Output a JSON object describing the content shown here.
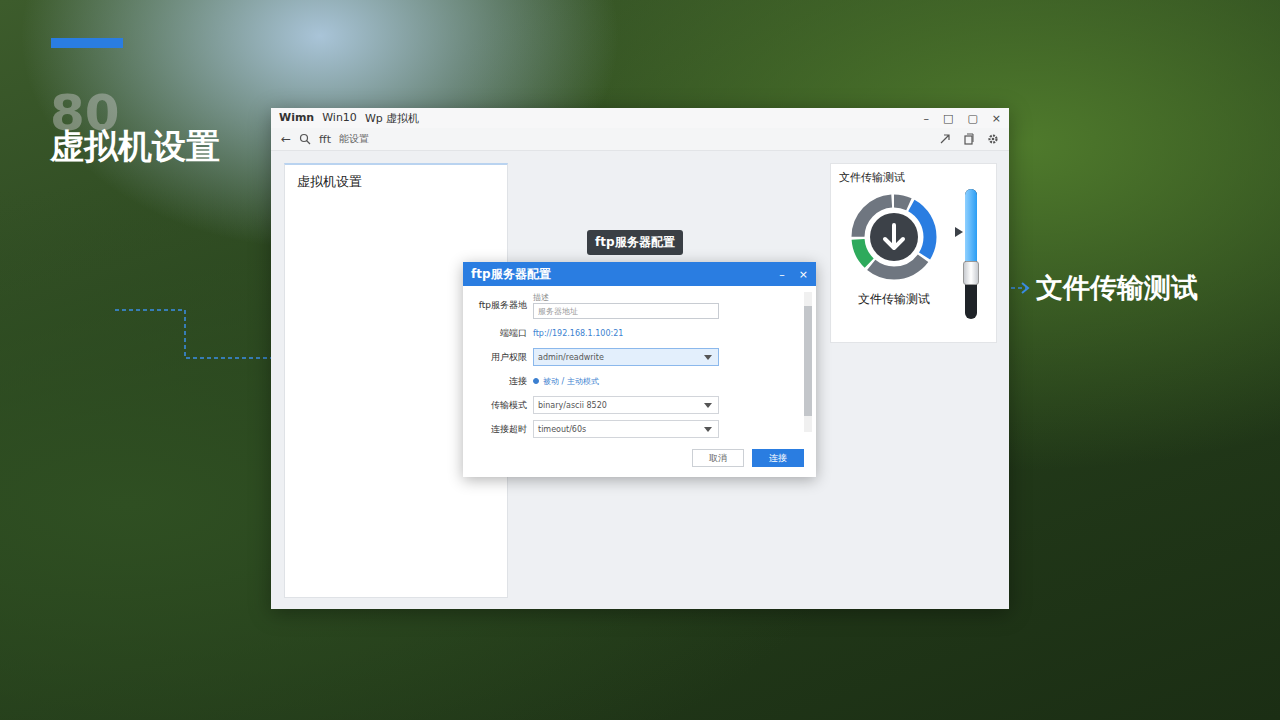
{
  "slide": {
    "number": "80",
    "title": "虚拟机设置",
    "callout": "文件传输测试"
  },
  "window": {
    "title_parts": [
      "Wimn",
      "Win10",
      "Wp 虚拟机"
    ],
    "controls": [
      "–",
      "□",
      "▢",
      "×"
    ]
  },
  "toolbar": {
    "back": "←",
    "search": "fft",
    "breadcrumb": "能设置"
  },
  "sidebar": {
    "title": "虚拟机设置"
  },
  "tooltip": "ftp服务器配置",
  "dialog": {
    "title": "ftp服务器配置",
    "controls": [
      "–",
      "×"
    ],
    "fields": [
      {
        "kind": "input",
        "label": "ftp服务器地",
        "hint": "描述",
        "placeholder": "服务器地址"
      },
      {
        "kind": "text",
        "label": "端端口",
        "value": "ftp://192.168.1.100:21"
      },
      {
        "kind": "select",
        "label": "用户权限",
        "value": "admin/readwrite",
        "highlighted": true
      },
      {
        "kind": "radio",
        "label": "连接",
        "value": "被动 / 主动模式",
        "selected": true
      },
      {
        "kind": "select",
        "label": "传输模式",
        "value": "binary/ascii 8520",
        "highlighted": false
      },
      {
        "kind": "select",
        "label": "连接超时",
        "value": "timeout/60s",
        "highlighted": false
      }
    ],
    "buttons": [
      {
        "label": "取消",
        "primary": false
      },
      {
        "label": "连接",
        "primary": true
      }
    ]
  },
  "transfer_card": {
    "title": "文件传输测试",
    "label": "文件传输测试",
    "segments": [
      {
        "share": 0.08,
        "color": "#6f7680"
      },
      {
        "share": 0.27,
        "color": "#2a7de1"
      },
      {
        "share": 0.27,
        "color": "#6f7680"
      },
      {
        "share": 0.13,
        "color": "#2eaa5c"
      },
      {
        "share": 0.25,
        "color": "#6f7680"
      }
    ],
    "slider": {
      "level": 0.55
    }
  }
}
